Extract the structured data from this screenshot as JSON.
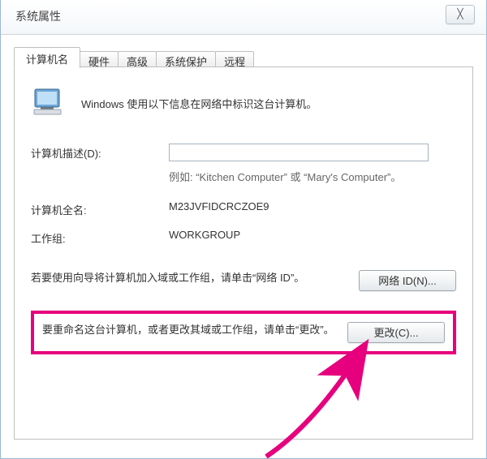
{
  "window": {
    "title": "系统属性",
    "close_glyph": "╳"
  },
  "tabs": [
    {
      "id": "computer-name",
      "label": "计算机名",
      "active": true
    },
    {
      "id": "hardware",
      "label": "硬件",
      "active": false
    },
    {
      "id": "advanced",
      "label": "高级",
      "active": false
    },
    {
      "id": "protection",
      "label": "系统保护",
      "active": false
    },
    {
      "id": "remote",
      "label": "远程",
      "active": false
    }
  ],
  "panel": {
    "intro": "Windows 使用以下信息在网络中标识这台计算机。",
    "description_label": "计算机描述(D):",
    "description_value": "",
    "example": "例如: “Kitchen Computer” 或 “Mary's Computer”。",
    "fullname_label": "计算机全名:",
    "fullname_value": "M23JVFIDCRCZOE9",
    "workgroup_label": "工作组:",
    "workgroup_value": "WORKGROUP",
    "netid_text": "若要使用向导将计算机加入域或工作组，请单击“网络 ID”。",
    "netid_button": "网络 ID(N)...",
    "change_text": "要重命名这台计算机，或者更改其域或工作组，请单击“更改”。",
    "change_button": "更改(C)..."
  },
  "annotations": {
    "arrow_color": "#e6007e",
    "highlight_color": "#e6007e"
  }
}
